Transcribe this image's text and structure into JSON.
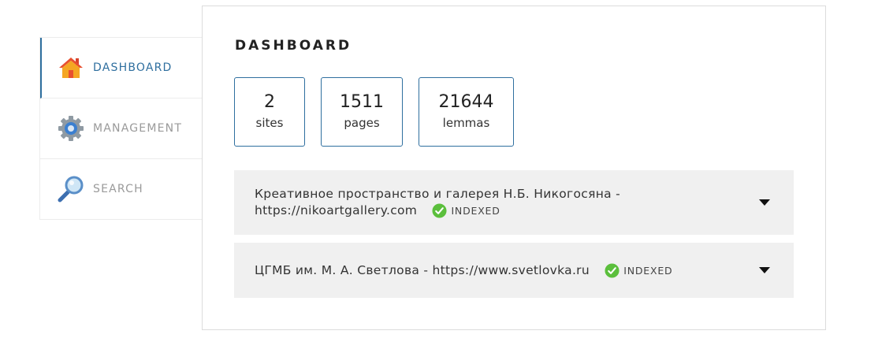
{
  "sidebar": {
    "items": [
      {
        "label": "DASHBOARD",
        "icon": "home-icon",
        "active": true
      },
      {
        "label": "MANAGEMENT",
        "icon": "gear-icon",
        "active": false
      },
      {
        "label": "SEARCH",
        "icon": "magnifier-icon",
        "active": false
      }
    ]
  },
  "dashboard": {
    "title": "DASHBOARD",
    "stats": [
      {
        "value": "2",
        "label": "sites"
      },
      {
        "value": "1511",
        "label": "pages"
      },
      {
        "value": "21644",
        "label": "lemmas"
      }
    ],
    "sites": [
      {
        "name": "Креативное пространство и галерея Н.Б. Никогосяна -",
        "url": "https://nikoartgallery.com",
        "status": "INDEXED"
      },
      {
        "name": "ЦГМБ им. М. А. Светлова -",
        "url": "https://www.svetlovka.ru",
        "status": "INDEXED"
      }
    ]
  },
  "colors": {
    "accent": "#2f6f9f",
    "status_ok": "#5bbf3c",
    "row_bg": "#f0f0f0"
  }
}
